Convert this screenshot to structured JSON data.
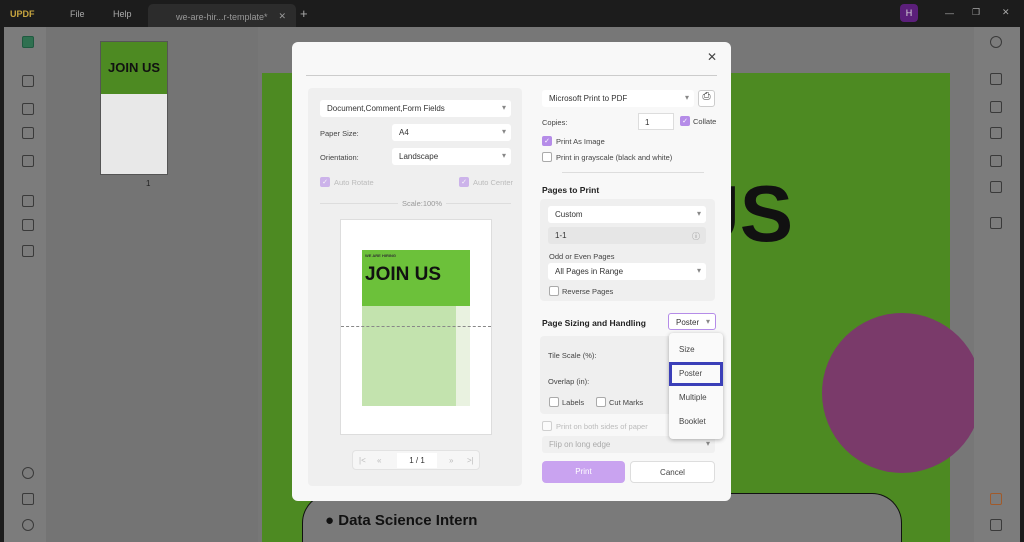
{
  "app": {
    "logo": "UPDF",
    "menu": [
      "File",
      "Help"
    ],
    "tab_title": "we-are-hir...r-template*",
    "user_initial": "H"
  },
  "thumbnail": {
    "page_label": "1",
    "title": "JOIN US"
  },
  "document": {
    "heading": "US",
    "section": "Data Science Intern"
  },
  "dialog": {
    "content_select": "Document,Comment,Form Fields",
    "paper_size_label": "Paper Size:",
    "paper_size": "A4",
    "orientation_label": "Orientation:",
    "orientation": "Landscape",
    "auto_rotate": "Auto Rotate",
    "auto_center": "Auto Center",
    "scale": "Scale:100%",
    "preview_title": "JOIN US",
    "preview_header": "WE ARE HIRING",
    "page_current": "1",
    "page_sep": "/",
    "page_total": "1",
    "printer": "Microsoft Print to PDF",
    "copies_label": "Copies:",
    "copies": "1",
    "collate": "Collate",
    "print_as_image": "Print As Image",
    "grayscale": "Print in grayscale (black and white)",
    "pages_heading": "Pages to Print",
    "pages_mode": "Custom",
    "range": "1-1",
    "odd_even_label": "Odd or Even Pages",
    "odd_even": "All Pages in Range",
    "reverse": "Reverse Pages",
    "sizing_heading": "Page Sizing and Handling",
    "sizing_mode": "Poster",
    "tile_scale": "Tile Scale (%):",
    "overlap": "Overlap (in):",
    "labels": "Labels",
    "cut_marks": "Cut Marks",
    "both_sides": "Print on both sides of paper",
    "flip": "Flip on long edge",
    "print": "Print",
    "cancel": "Cancel",
    "menu": [
      "Size",
      "Poster",
      "Multiple",
      "Booklet"
    ]
  },
  "colors": {
    "accent": "#b58ce8",
    "highlight": "#3b3fb8",
    "green": "#6cc13a"
  }
}
